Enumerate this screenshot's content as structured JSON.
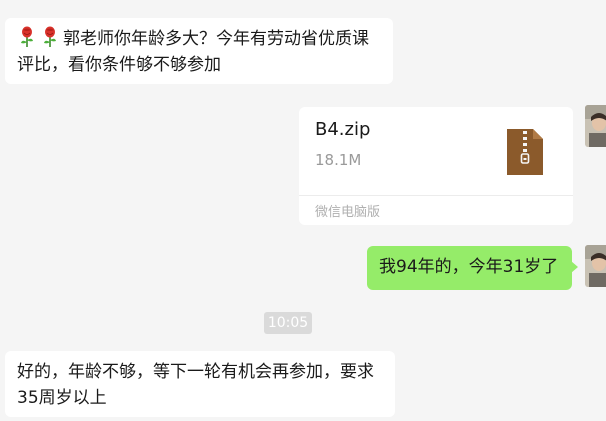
{
  "messages": {
    "incoming_1": {
      "text": "郭老师你年龄多大？今年有劳动省优质课评比，看你条件够不够参加",
      "emoji": "rose-icon"
    },
    "file": {
      "name": "B4.zip",
      "size": "18.1M",
      "source": "微信电脑版",
      "icon": "zip-file-icon"
    },
    "outgoing_1": {
      "text": "我94年的，今年31岁了"
    },
    "timestamp": "10:05",
    "incoming_2": {
      "text": "好的，年龄不够，等下一轮有机会再参加，要求35周岁以上"
    }
  },
  "colors": {
    "background": "#f5f5f5",
    "incoming_bubble": "#ffffff",
    "outgoing_bubble": "#95ec69",
    "zip_icon": "#8b5a2b",
    "timestamp_bg": "#dadada"
  }
}
